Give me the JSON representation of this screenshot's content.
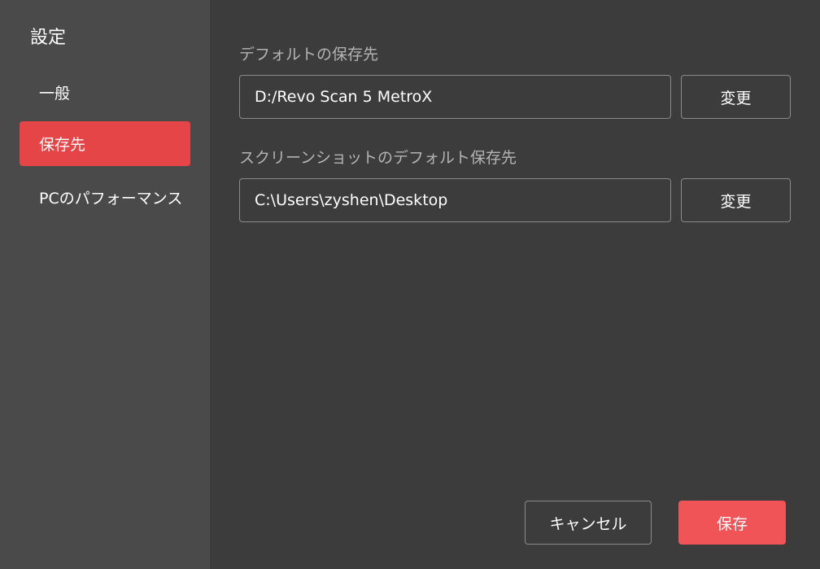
{
  "sidebar": {
    "title": "設定",
    "items": [
      {
        "label": "一般",
        "active": false
      },
      {
        "label": "保存先",
        "active": true
      },
      {
        "label": "PCのパフォーマンス",
        "active": false
      }
    ]
  },
  "main": {
    "default_save": {
      "label": "デフォルトの保存先",
      "path": "D:/Revo Scan 5 MetroX",
      "button": "変更"
    },
    "screenshot_save": {
      "label": "スクリーンショットのデフォルト保存先",
      "path": "C:\\Users\\zyshen\\Desktop",
      "button": "変更"
    }
  },
  "footer": {
    "cancel_label": "キャンセル",
    "save_label": "保存"
  },
  "colors": {
    "accent": "#e64547",
    "save_button": "#f05457",
    "sidebar_bg": "#4a4a4a",
    "main_bg": "#3c3c3c"
  }
}
